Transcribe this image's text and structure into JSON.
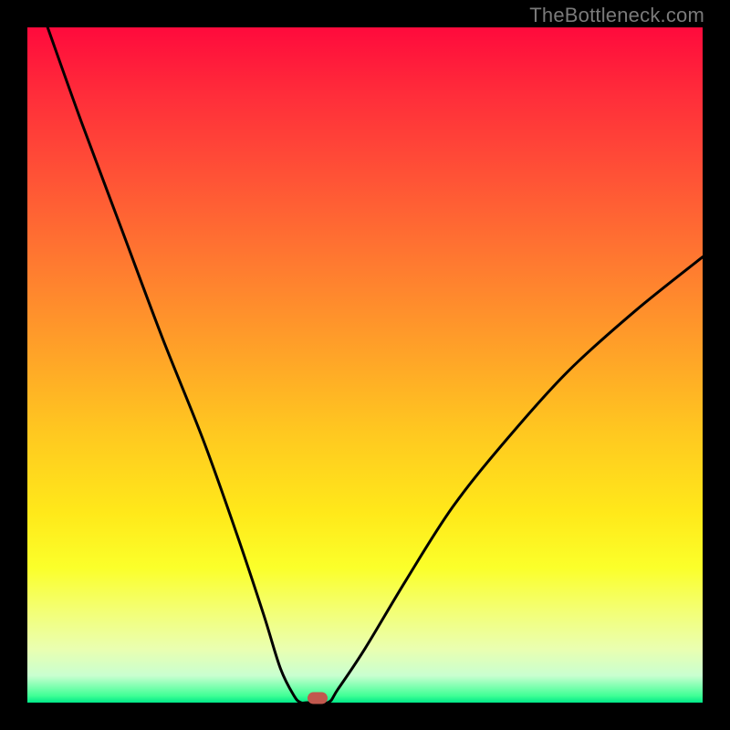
{
  "watermark": "TheBottleneck.com",
  "colors": {
    "frame": "#000000",
    "gradient_top": "#ff0a3c",
    "gradient_bottom": "#00e888",
    "curve": "#000000",
    "marker": "#c1584e"
  },
  "chart_data": {
    "type": "line",
    "title": "",
    "xlabel": "",
    "ylabel": "",
    "xlim": [
      0,
      1
    ],
    "ylim": [
      0,
      1
    ],
    "x": [
      0.03,
      0.08,
      0.14,
      0.2,
      0.26,
      0.31,
      0.35,
      0.375,
      0.395,
      0.405,
      0.415,
      0.445,
      0.46,
      0.5,
      0.56,
      0.63,
      0.71,
      0.8,
      0.9,
      1.0
    ],
    "values": [
      1.0,
      0.86,
      0.7,
      0.54,
      0.39,
      0.25,
      0.13,
      0.05,
      0.01,
      0.0,
      0.0,
      0.0,
      0.02,
      0.08,
      0.18,
      0.29,
      0.39,
      0.49,
      0.58,
      0.66
    ],
    "marker": {
      "x": 0.43,
      "y": 0.0
    },
    "note": "Values are normalized fractions of the plot area (0 at bottom, 1 at top); estimated from pixel positions since axes are unlabeled."
  }
}
